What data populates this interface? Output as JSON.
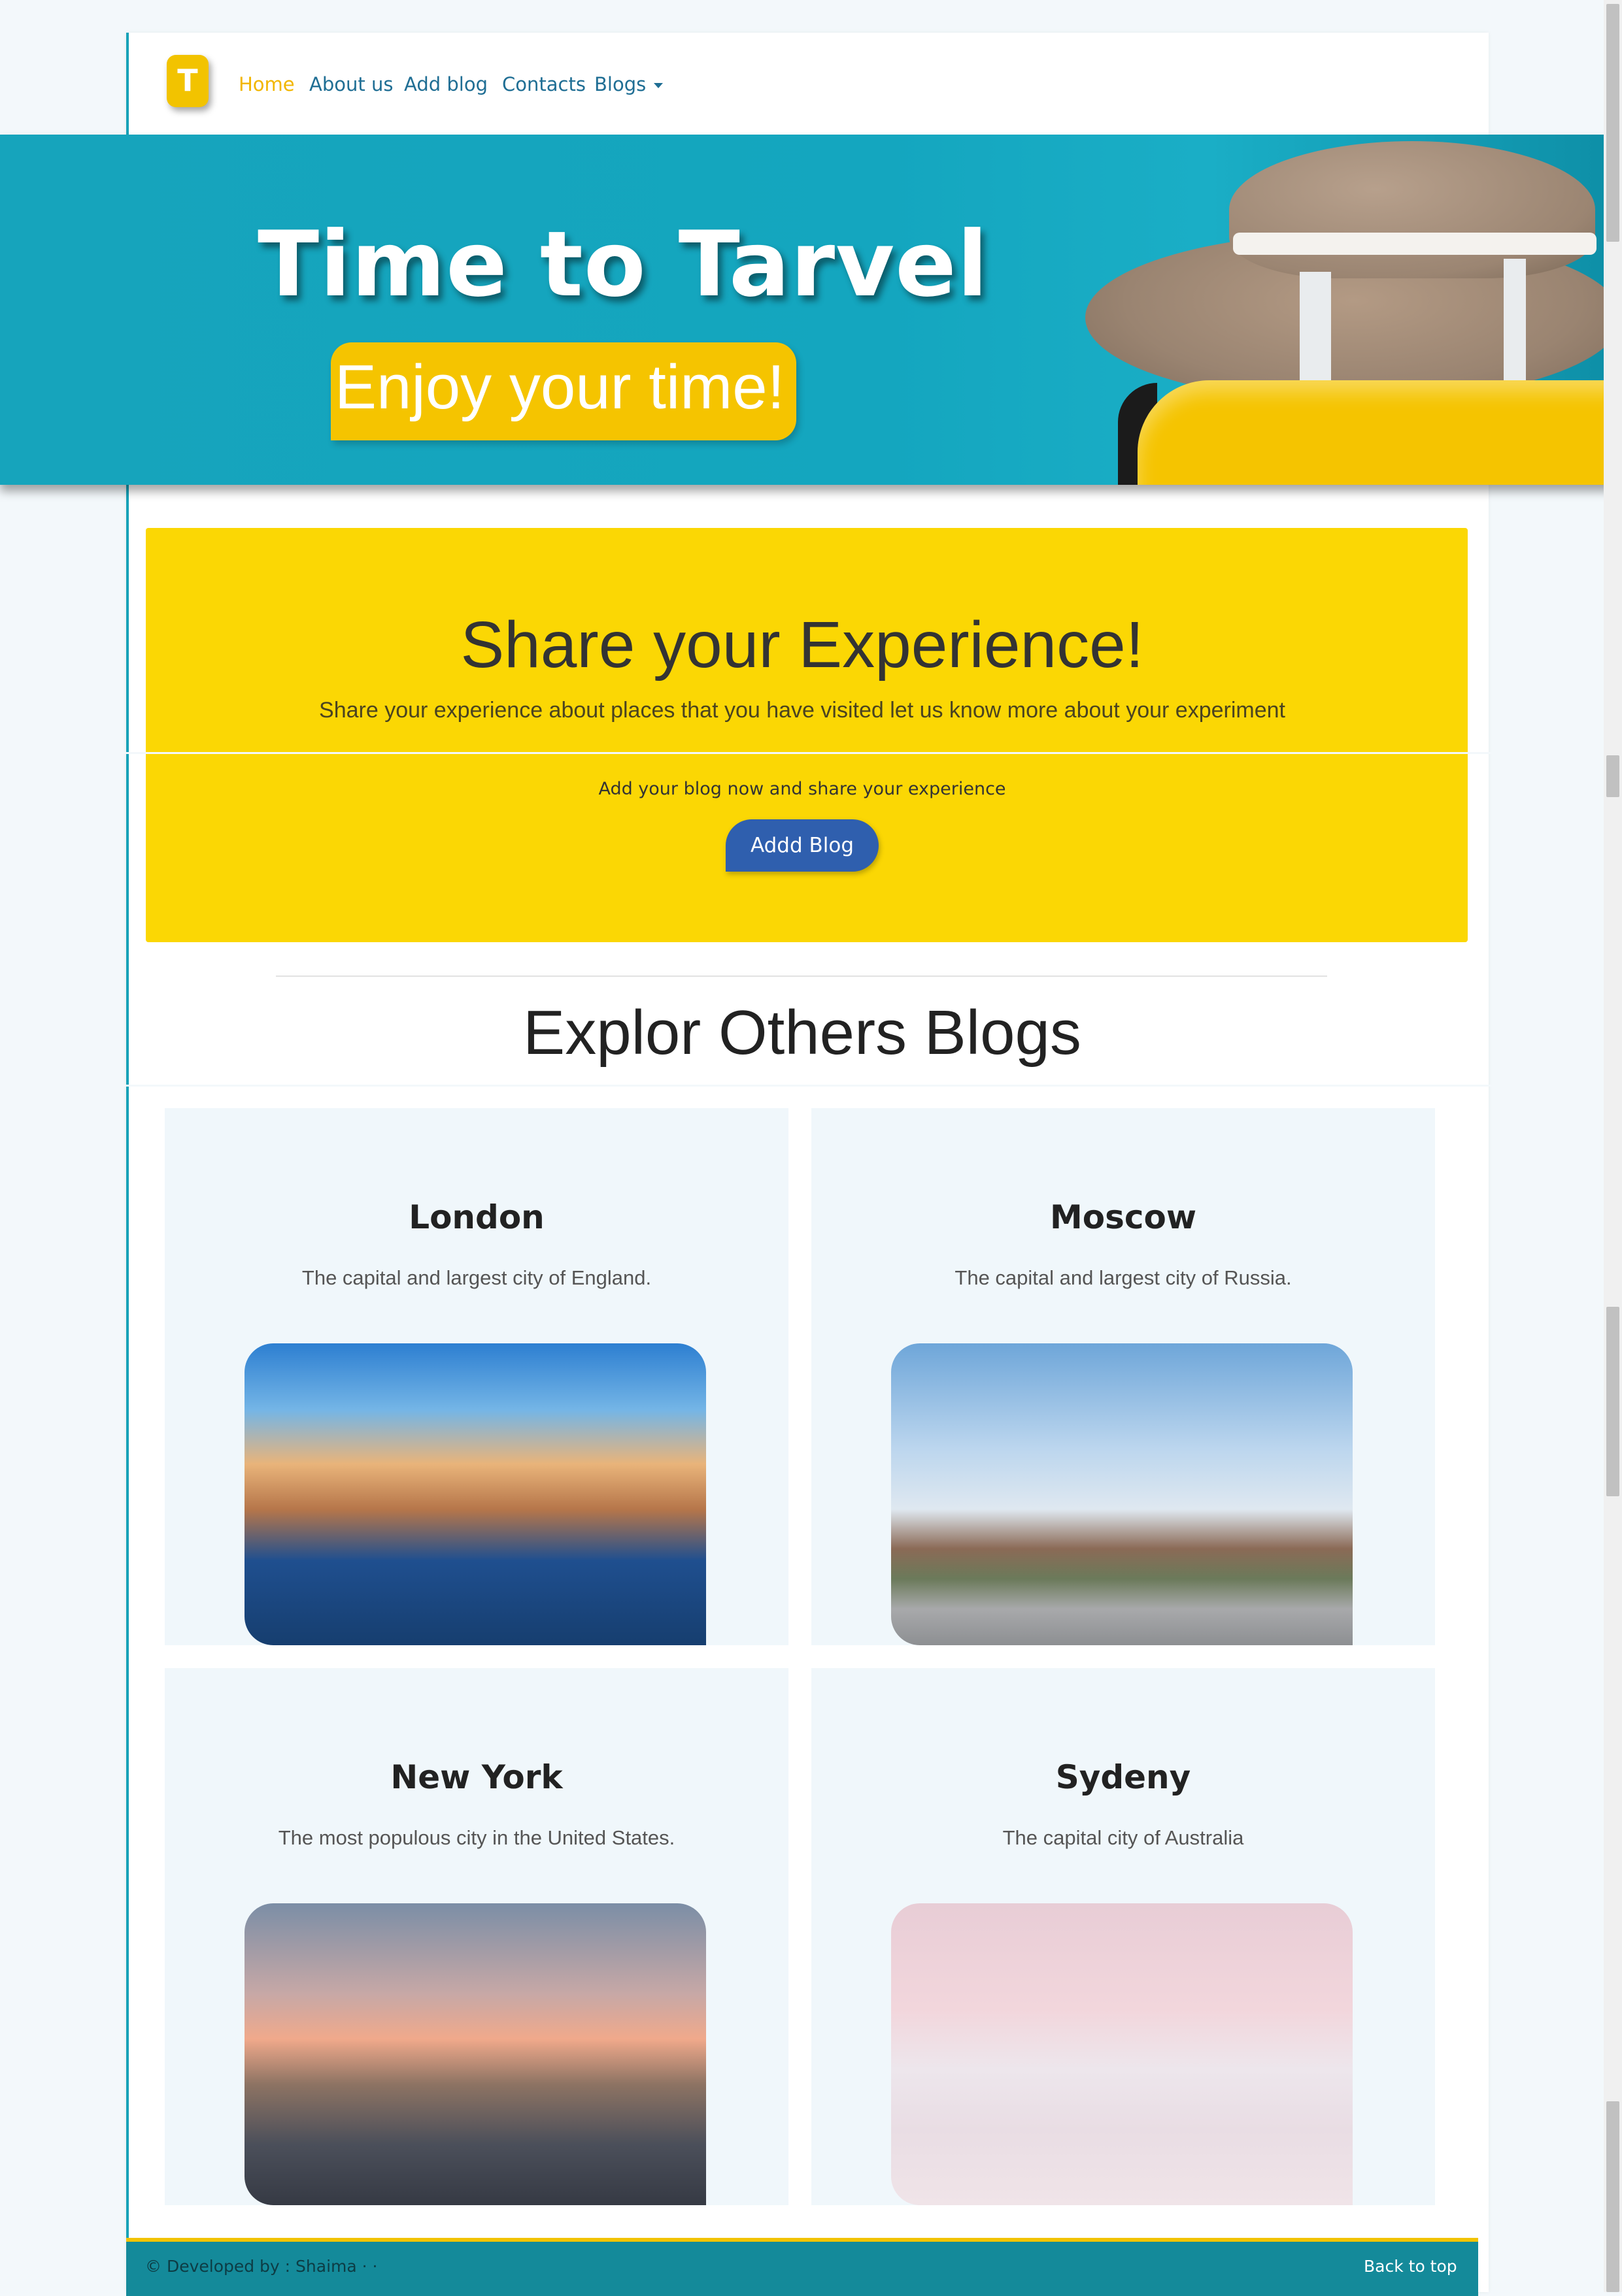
{
  "nav": {
    "logo_letter": "T",
    "links": [
      "Home",
      "About us",
      "Add blog",
      "Contacts",
      "Blogs"
    ]
  },
  "hero": {
    "title": "Time to Tarvel",
    "subtitle": "Enjoy your time!"
  },
  "share": {
    "title": "Share your Experience!",
    "description": "Share your experience about places that you have visited let us know more about your experiment",
    "cta_text": "Add your blog now and share your experience",
    "button_label": "Addd Blog"
  },
  "explore": {
    "title": "Explor Others Blogs",
    "cards": [
      {
        "title": "London",
        "text": "The capital and largest city of England."
      },
      {
        "title": "Moscow",
        "text": "The capital and largest city of Russia."
      },
      {
        "title": "New York",
        "text": "The most populous city in the United States."
      },
      {
        "title": "Sydeny",
        "text": "The capital city of Australia"
      }
    ]
  },
  "footer": {
    "left": "© Developed by : Shaima ·            ·",
    "right": "Back to top"
  },
  "colors": {
    "accent_yellow": "#fbd704",
    "teal": "#17a2b8",
    "button_blue": "#2f5fae"
  }
}
